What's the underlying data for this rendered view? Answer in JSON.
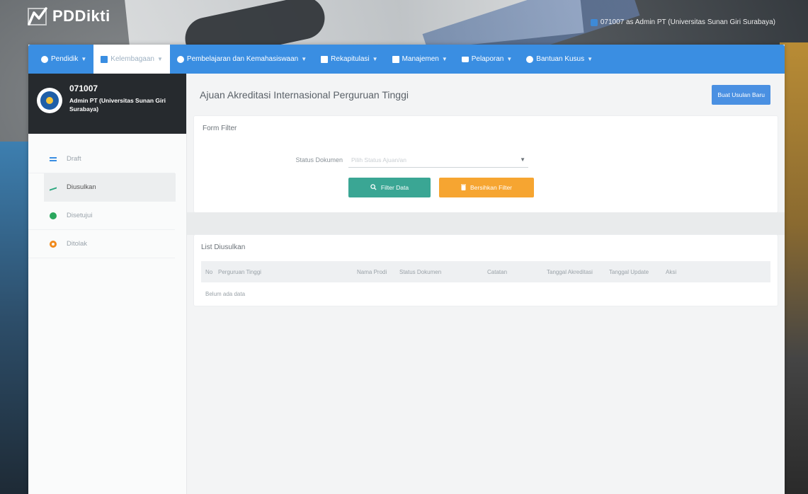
{
  "brand": {
    "name": "PDDikti"
  },
  "header_user": "071007 as Admin PT (Universitas Sunan Giri Surabaya)",
  "nav": [
    {
      "label": "Pendidik",
      "icon": "user-icon",
      "active": false
    },
    {
      "label": "Kelembagaan",
      "icon": "building-icon",
      "active": true
    },
    {
      "label": "Pembelajaran dan Kemahasiswaan",
      "icon": "user-icon",
      "active": false
    },
    {
      "label": "Rekapitulasi",
      "icon": "box-icon",
      "active": false
    },
    {
      "label": "Manajemen",
      "icon": "file-icon",
      "active": false
    },
    {
      "label": "Pelaporan",
      "icon": "folder-icon",
      "active": false
    },
    {
      "label": "Bantuan Kusus",
      "icon": "user-icon",
      "active": false
    }
  ],
  "profile": {
    "id": "071007",
    "name": "Admin PT (Universitas Sunan Giri Surabaya)"
  },
  "sidebar": {
    "items": [
      {
        "label": "Draft",
        "icon": "list-icon"
      },
      {
        "label": "Diusulkan",
        "icon": "chart-line-icon"
      },
      {
        "label": "Disetujui",
        "icon": "check-circle-icon"
      },
      {
        "label": "Ditolak",
        "icon": "ring-icon"
      }
    ]
  },
  "main": {
    "title": "Ajuan Akreditasi Internasional Perguruan Tinggi",
    "new_button": "Buat Usulan Baru"
  },
  "filter": {
    "title": "Form Filter",
    "status_label": "Status Dokumen",
    "status_placeholder": "Pilih Status Ajuan/an",
    "filter_button": "Filter Data",
    "clear_button": "Bersihkan Filter"
  },
  "list": {
    "title": "List Diusulkan",
    "columns": [
      "No",
      "Perguruan Tinggi",
      "Nama Prodi",
      "Status Dokumen",
      "Catatan",
      "Tanggal Akreditasi",
      "Tanggal Update",
      "Aksi"
    ],
    "empty_text": "Belum ada data"
  },
  "colors": {
    "navbar": "#3a8ee2",
    "filter_button": "#3aa694",
    "clear_button": "#f6a531",
    "new_button": "#4a90e2",
    "profile_bg": "#262a2e"
  }
}
